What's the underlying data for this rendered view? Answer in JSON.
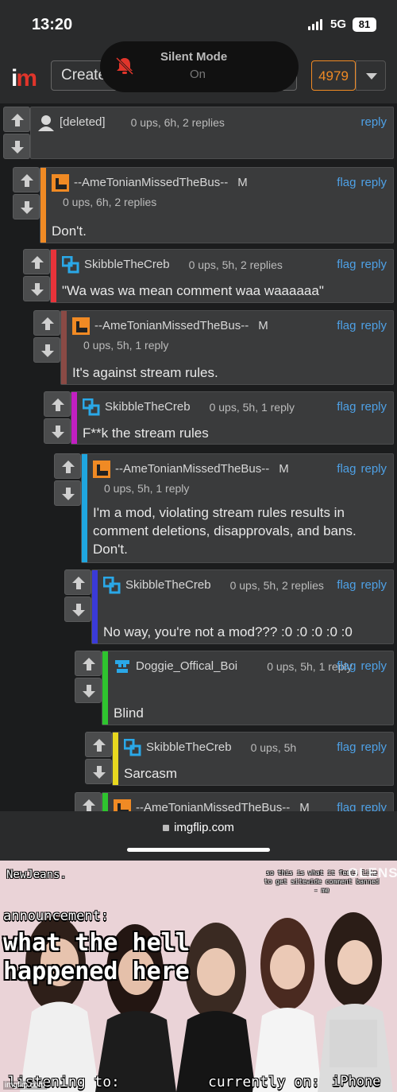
{
  "status_bar": {
    "time": "13:20",
    "network": "5G",
    "battery": "81"
  },
  "header": {
    "logo": "im",
    "create_label": "Create",
    "notification": {
      "title": "Silent Mode",
      "subtitle": "On"
    },
    "points": "4979"
  },
  "comments": [
    {
      "user": "[deleted]",
      "meta": "0 ups, 6h, 2 replies",
      "body": "",
      "mod": "",
      "actions": [
        "reply"
      ],
      "color": "",
      "avatar": "default"
    },
    {
      "user": "--AmeTonianMissedTheBus--",
      "mod": "M",
      "meta": "0 ups, 6h, 2 replies",
      "body": "Don't.",
      "actions": [
        "flag",
        "reply"
      ],
      "color": "#f08a24",
      "avatar": "orange"
    },
    {
      "user": "SkibbleTheCreb",
      "mod": "",
      "meta": "0 ups, 5h, 2 replies",
      "body": "\"Wa was wa mean comment waa waaaaaa\"",
      "actions": [
        "flag",
        "reply"
      ],
      "color": "#e8333a",
      "avatar": "blue"
    },
    {
      "user": "--AmeTonianMissedTheBus--",
      "mod": "M",
      "meta": "0 ups, 5h, 1 reply",
      "body": "It's against stream rules.",
      "actions": [
        "flag",
        "reply"
      ],
      "color": "#8a4a45",
      "avatar": "orange"
    },
    {
      "user": "SkibbleTheCreb",
      "mod": "",
      "meta": "0 ups, 5h, 1 reply",
      "body": "F**k the stream rules",
      "actions": [
        "flag",
        "reply"
      ],
      "color": "#c21fc2",
      "avatar": "blue"
    },
    {
      "user": "--AmeTonianMissedTheBus--",
      "mod": "M",
      "meta": "0 ups, 5h, 1 reply",
      "body": "I'm a mod, violating stream rules results in comment deletions, disapprovals, and bans. Don't.",
      "actions": [
        "flag",
        "reply"
      ],
      "color": "#1fa6e0",
      "avatar": "orange"
    },
    {
      "user": "SkibbleTheCreb",
      "mod": "",
      "meta": "0 ups, 5h, 2 replies",
      "body": "No way, you're not a mod??? :0 :0 :0 :0 :0",
      "actions": [
        "flag",
        "reply"
      ],
      "color": "#3a3ad8",
      "avatar": "blue"
    },
    {
      "user": "Doggie_Offical_Boi",
      "mod": "",
      "meta": "0 ups, 5h, 1 reply",
      "body": "Blind",
      "actions": [
        "flag",
        "reply"
      ],
      "color": "#2fc42f",
      "avatar": "dog"
    },
    {
      "user": "SkibbleTheCreb",
      "mod": "",
      "meta": "0 ups, 5h",
      "body": "Sarcasm",
      "actions": [
        "flag",
        "reply"
      ],
      "color": "#e8d81f",
      "avatar": "blue"
    },
    {
      "user": "--AmeTonianMissedTheBus--",
      "mod": "M",
      "meta": "",
      "body": "",
      "actions": [
        "flag",
        "reply"
      ],
      "color": "#2fc42f",
      "avatar": "orange"
    }
  ],
  "browser": {
    "url": "imgflip.com"
  },
  "template": {
    "newjeans": "NewJeans.",
    "note": "so this is what it feels like to get sitewide comment banned - me",
    "brand": "OLENS",
    "announcement_label": "announcement:",
    "announcement": "what the hell happened here",
    "listening_label": "listening to:",
    "currently_label": "currently on:",
    "currently_value": "iPhone",
    "watermark": "imgflip.com"
  },
  "colors": {
    "link": "#4ea1e6",
    "points_accent": "#f08a24",
    "logo_red": "#e0352b"
  }
}
